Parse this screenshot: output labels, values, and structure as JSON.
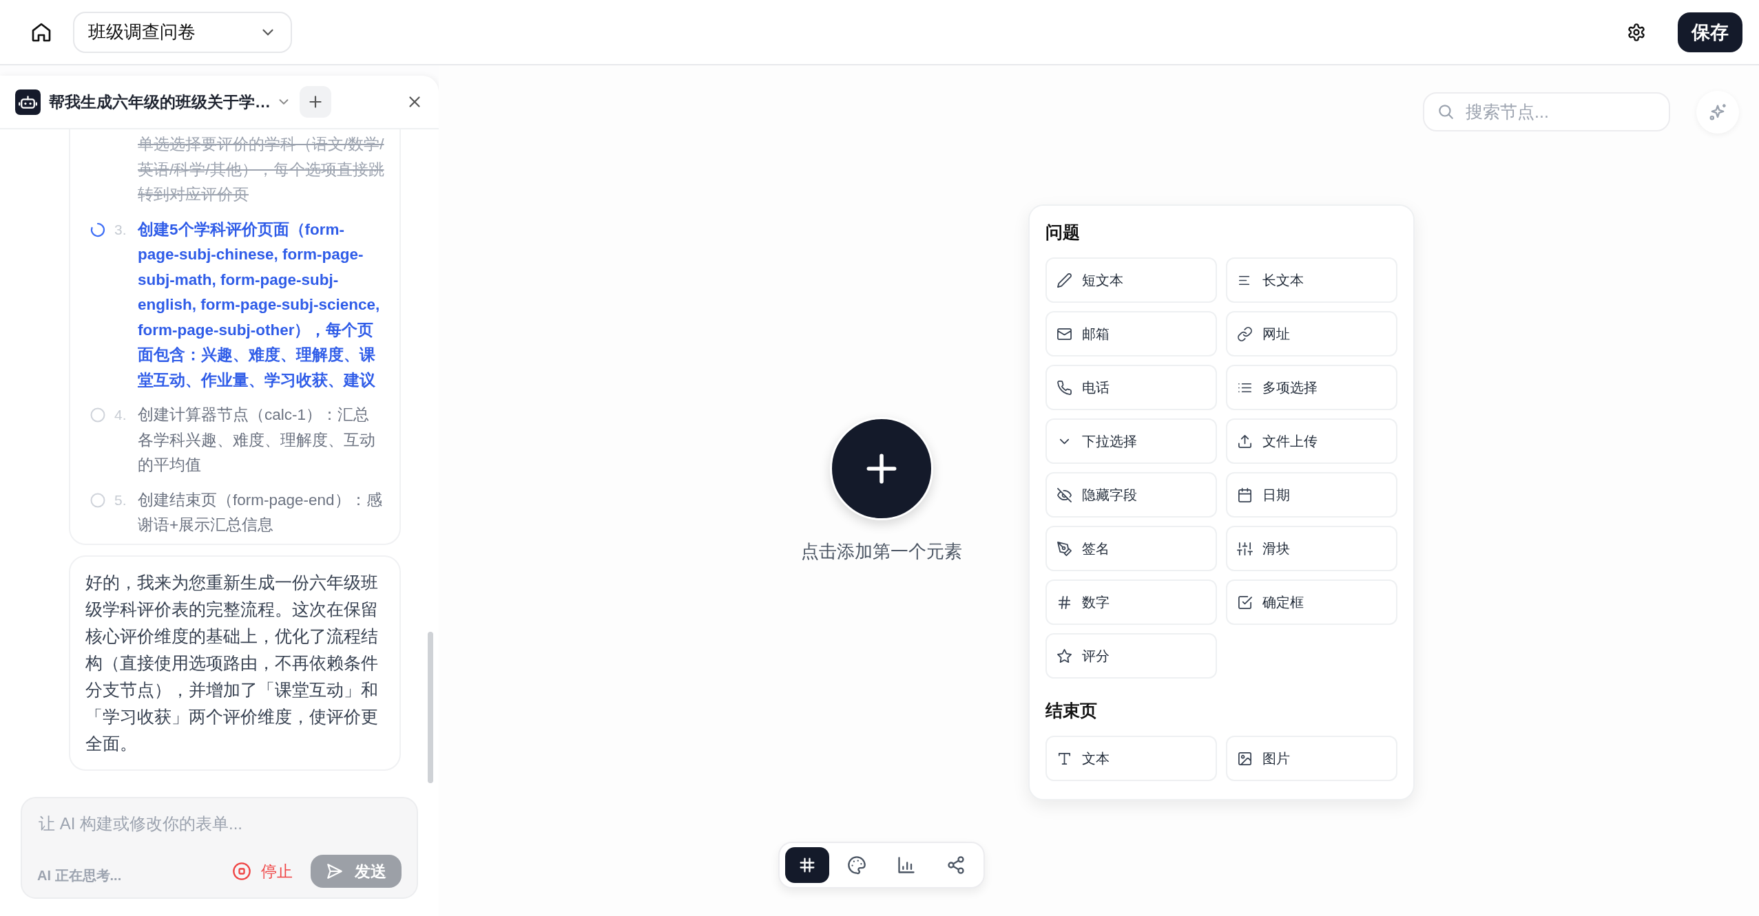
{
  "header": {
    "form_select": {
      "value": "班级调查问卷"
    },
    "save_button": "保存"
  },
  "chat": {
    "title": "帮我生成六年级的班级关于学…",
    "plan": [
      {
        "done": true,
        "in_progress": false,
        "text": "单选选择要评价的学科（语文/数学/英语/科学/其他），每个选项直接跳转到对应评价页"
      },
      {
        "done": false,
        "in_progress": true,
        "number": "3.",
        "text": "创建5个学科评价页面（form-page-subj-chinese, form-page-subj-math, form-page-subj-english, form-page-subj-science, form-page-subj-other），每个页面包含：兴趣、难度、理解度、课堂互动、作业量、学习收获、建议"
      },
      {
        "done": false,
        "in_progress": false,
        "number": "4.",
        "text": "创建计算器节点（calc-1）：汇总各学科兴趣、难度、理解度、互动的平均值"
      },
      {
        "done": false,
        "in_progress": false,
        "number": "5.",
        "text": "创建结束页（form-page-end）：感谢语+展示汇总信息"
      }
    ],
    "message": "好的，我来为您重新生成一份六年级班级学科评价表的完整流程。这次在保留核心评价维度的基础上，优化了流程结构（直接使用选项路由，不再依赖条件分支节点），并增加了「课堂互动」和「学习收获」两个评价维度，使评价更全面。",
    "input": {
      "placeholder": "让 AI 构建或修改你的表单..."
    },
    "status_text": "AI 正在思考...",
    "stop_button": "停止",
    "send_button": {
      "label": "发送",
      "disabled": true
    }
  },
  "canvas": {
    "search": {
      "placeholder": "搜索节点..."
    },
    "empty_hint": "点击添加第一个元素",
    "toolbar": [
      {
        "kind": "grid",
        "selected": true
      },
      {
        "kind": "palette",
        "selected": false
      },
      {
        "kind": "chart",
        "selected": false
      },
      {
        "kind": "share",
        "selected": false
      }
    ]
  },
  "palette": {
    "sections": [
      {
        "title": "问题",
        "items": [
          {
            "kind": "short-text",
            "label": "短文本"
          },
          {
            "kind": "long-text",
            "label": "长文本"
          },
          {
            "kind": "email",
            "label": "邮箱"
          },
          {
            "kind": "url",
            "label": "网址"
          },
          {
            "kind": "phone",
            "label": "电话"
          },
          {
            "kind": "multi-choice",
            "label": "多项选择"
          },
          {
            "kind": "dropdown",
            "label": "下拉选择"
          },
          {
            "kind": "upload",
            "label": "文件上传"
          },
          {
            "kind": "hidden",
            "label": "隐藏字段"
          },
          {
            "kind": "date",
            "label": "日期"
          },
          {
            "kind": "signature",
            "label": "签名"
          },
          {
            "kind": "slider",
            "label": "滑块"
          },
          {
            "kind": "number",
            "label": "数字"
          },
          {
            "kind": "checkbox",
            "label": "确定框"
          },
          {
            "kind": "rating",
            "label": "评分"
          }
        ]
      },
      {
        "title": "结束页",
        "items": [
          {
            "kind": "text",
            "label": "文本"
          },
          {
            "kind": "image",
            "label": "图片"
          }
        ]
      }
    ]
  }
}
